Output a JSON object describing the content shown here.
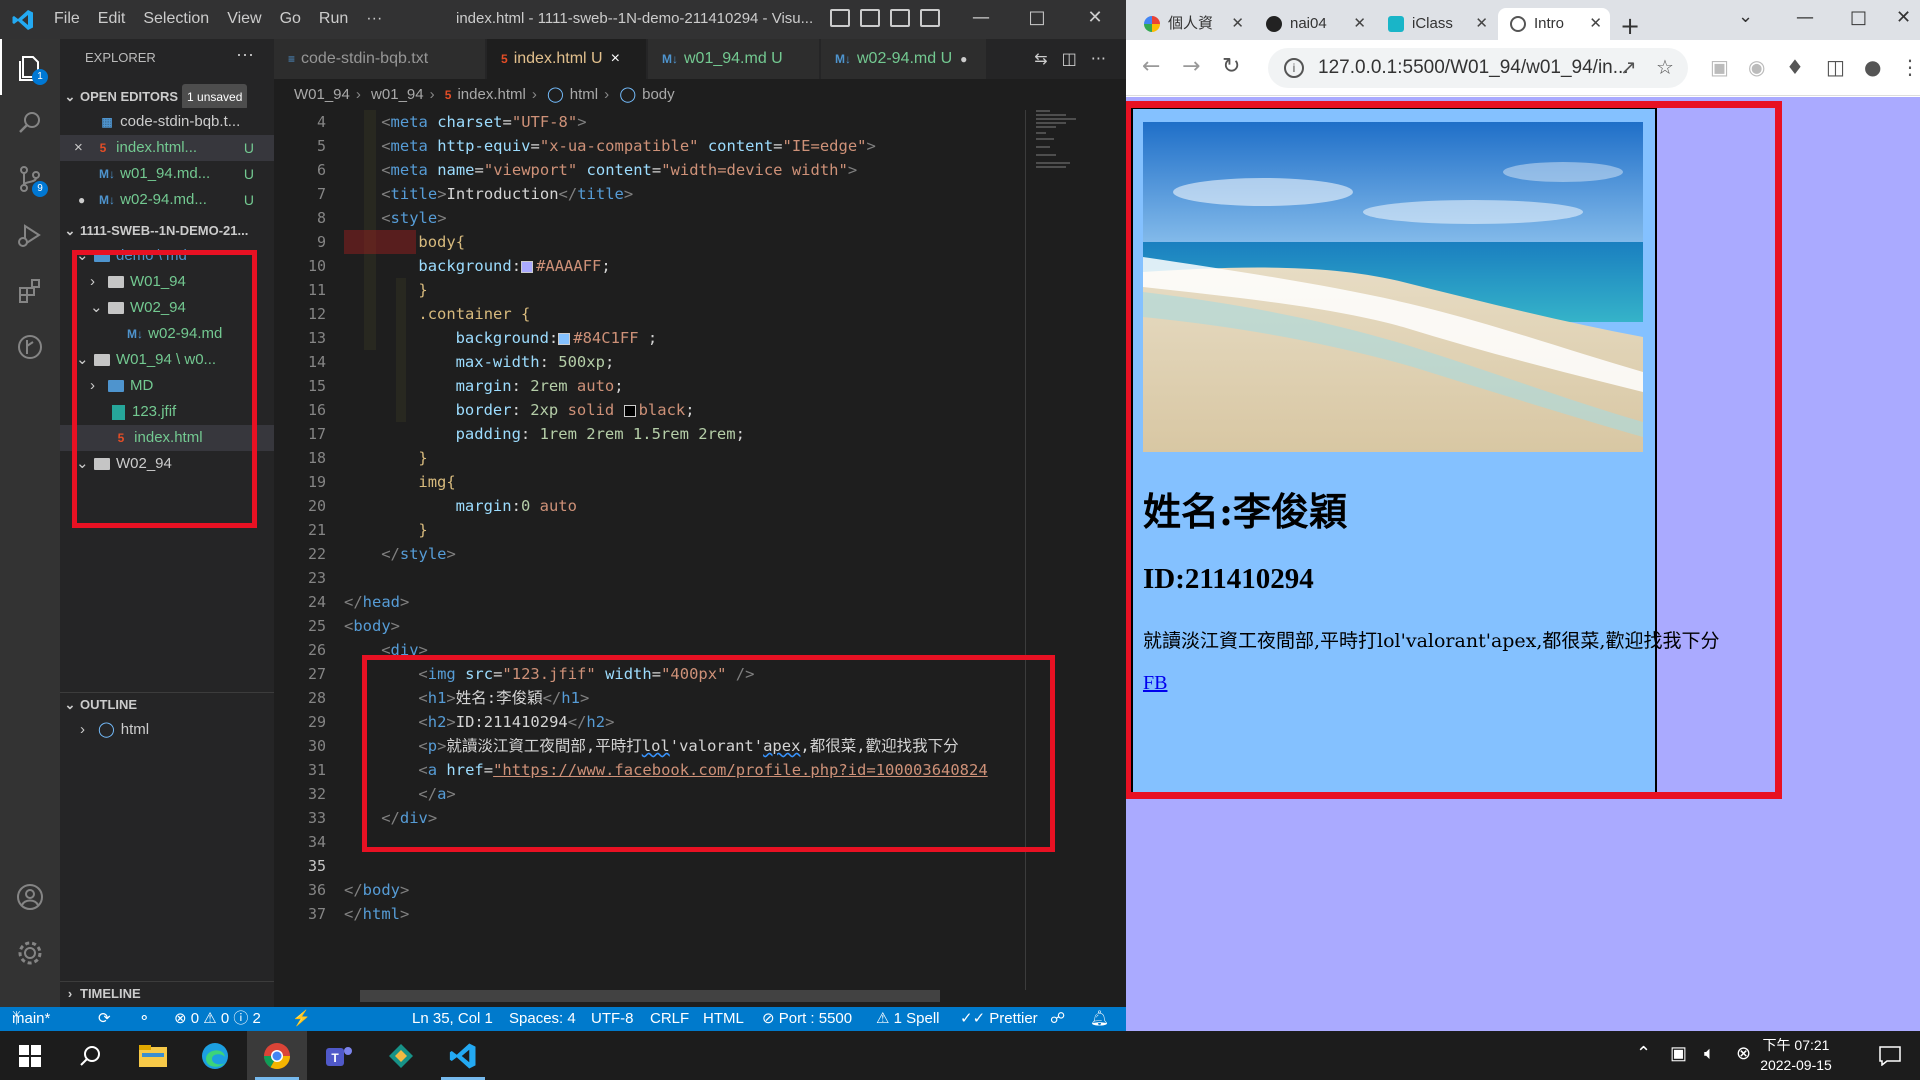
{
  "vscode": {
    "menu": [
      "File",
      "Edit",
      "Selection",
      "View",
      "Go",
      "Run",
      "···"
    ],
    "window_title": "index.html - 1111-sweb--1N-demo-211410294 - Visu...",
    "explorer": {
      "title": "EXPLORER",
      "open_editors_label": "OPEN EDITORS",
      "unsaved_badge": "1 unsaved",
      "open_editors": [
        {
          "name": "code-stdin-bqb.t...",
          "icon": "MD",
          "mark": ""
        },
        {
          "name": "index.html...",
          "icon": "HTML",
          "mark": "U",
          "close": "×"
        },
        {
          "name": "w01_94.md...",
          "icon": "M↓",
          "mark": "U"
        },
        {
          "name": "w02-94.md...",
          "icon": "M↓",
          "mark": "U",
          "dot": "●"
        }
      ],
      "workspace_label": "1111-SWEB--1N-DEMO-21...",
      "tree": [
        {
          "name": "demo \\ md",
          "kind": "folder-md",
          "depth": 1,
          "chev": "⌄"
        },
        {
          "name": "W01_94",
          "kind": "folder",
          "depth": 2,
          "chev": "›"
        },
        {
          "name": "W02_94",
          "kind": "folder",
          "depth": 2,
          "chev": "⌄"
        },
        {
          "name": "w02-94.md",
          "kind": "md",
          "depth": 3,
          "chev": ""
        },
        {
          "name": "W01_94 \\ w0...",
          "kind": "folder",
          "depth": 1,
          "chev": "⌄"
        },
        {
          "name": "MD",
          "kind": "folder-md",
          "depth": 2,
          "chev": "›"
        },
        {
          "name": "123.jfif",
          "kind": "img",
          "depth": 2,
          "chev": ""
        },
        {
          "name": "index.html",
          "kind": "html",
          "depth": 2,
          "chev": ""
        },
        {
          "name": "W02_94",
          "kind": "folder",
          "depth": 1,
          "chev": "⌄"
        }
      ],
      "outline_label": "OUTLINE",
      "outline_item": "html",
      "timeline_label": "TIMELINE"
    },
    "tabs": [
      {
        "label": "code-stdin-bqb.txt",
        "icon": "≡",
        "mod": "",
        "active": false
      },
      {
        "label": "index.html U",
        "icon": "5",
        "mod": "×",
        "active": true
      },
      {
        "label": "w01_94.md U",
        "icon": "M↓",
        "mod": "",
        "active": false
      },
      {
        "label": "w02-94.md U",
        "icon": "M↓",
        "mod": "●",
        "active": false
      }
    ],
    "breadcrumb": [
      "W01_94",
      "w01_94",
      "index.html",
      "html",
      "body"
    ],
    "line_numbers": [
      "4",
      "5",
      "6",
      "7",
      "8",
      "9",
      "10",
      "11",
      "12",
      "13",
      "14",
      "15",
      "16",
      "17",
      "18",
      "19",
      "20",
      "21",
      "22",
      "23",
      "24",
      "25",
      "26",
      "27",
      "28",
      "29",
      "30",
      "31",
      "32",
      "33",
      "34",
      "35",
      "36",
      "37"
    ],
    "current_line": "35",
    "code": {
      "l4": [
        "<",
        "meta",
        " charset",
        "=",
        "\"UTF-8\"",
        ">"
      ],
      "l5": [
        "<",
        "meta",
        " http-equiv",
        "=",
        "\"x-ua-compatible\"",
        " content",
        "=",
        "\"IE=edge\"",
        ">"
      ],
      "l6": [
        "<",
        "meta",
        " name",
        "=",
        "\"viewport\"",
        " content",
        "=",
        "\"width=device width\"",
        ">"
      ],
      "l7": [
        "<",
        "title",
        ">",
        "Introduction",
        "</",
        "title",
        ">"
      ],
      "l8": [
        "<",
        "style",
        ">"
      ],
      "l9": [
        "body{"
      ],
      "l10": [
        "background",
        ":",
        "#AAAAFF",
        ";"
      ],
      "l11": [
        "}"
      ],
      "l12": [
        ".container {"
      ],
      "l13": [
        "background",
        ":",
        "#84C1FF",
        " ;"
      ],
      "l14": [
        "max-width",
        ": ",
        "500xp",
        ";"
      ],
      "l15": [
        "margin",
        ": ",
        "2rem",
        " auto",
        ";"
      ],
      "l16": [
        "border",
        ": ",
        "2xp",
        " solid ",
        "black",
        ";"
      ],
      "l17": [
        "padding",
        ": ",
        "1rem 2rem 1.5rem 2rem",
        ";"
      ],
      "l18": [
        "}"
      ],
      "l19": [
        "img{"
      ],
      "l20": [
        "margin",
        ":",
        "0",
        " auto"
      ],
      "l21": [
        "}"
      ],
      "l22": [
        "</",
        "style",
        ">"
      ],
      "l24": [
        "</",
        "head",
        ">"
      ],
      "l25": [
        "<",
        "body",
        ">"
      ],
      "l26": [
        "<",
        "div",
        ">"
      ],
      "l27": [
        "<",
        "img",
        " src",
        "=",
        "\"123.jfif\"",
        " width",
        "=",
        "\"400px\"",
        " />"
      ],
      "l28": [
        "<",
        "h1",
        ">",
        "姓名:李俊穎",
        "</",
        "h1",
        ">"
      ],
      "l29": [
        "<",
        "h2",
        ">",
        "ID:211410294",
        "</",
        "h2",
        ">"
      ],
      "l30": [
        "<",
        "p",
        ">",
        "就讀淡江資工夜間部,平時打",
        "lol",
        "'valorant'",
        "apex",
        ",都很菜,歡迎找我下分"
      ],
      "l31": [
        "<",
        "a",
        " href",
        "=",
        "\"https://www.facebook.com/profile.php?id=100003640824"
      ],
      "l32": [
        "</",
        "a",
        ">"
      ],
      "l33": [
        "</",
        "div",
        ">"
      ],
      "l36": [
        "</",
        "body",
        ">"
      ],
      "l37": [
        "</",
        "html",
        ">"
      ]
    },
    "status": {
      "branch": "main*",
      "problems": "⊗ 0 ⚠ 0 ⓘ 2",
      "cursor": "Ln 35, Col 1",
      "spaces": "Spaces: 4",
      "encoding": "UTF-8",
      "eol": "CRLF",
      "language": "HTML",
      "port": "⊘ Port : 5500",
      "spell": "⚠ 1 Spell",
      "prettier": "✓✓ Prettier"
    }
  },
  "chrome": {
    "tabs": [
      {
        "label": "個人資",
        "fav": "G"
      },
      {
        "label": "nai04",
        "fav": "gh"
      },
      {
        "label": "iClass",
        "fav": "ic"
      },
      {
        "label": "Intro",
        "fav": "globe",
        "active": true
      }
    ],
    "new_tab": "+",
    "url": "127.0.0.1:5500/W01_94/w01_94/in...",
    "page": {
      "name": "姓名:李俊穎",
      "id": "ID:211410294",
      "desc": "就讀淡江資工夜間部,平時打lol'valorant'apex,都很菜,歡迎找我下分",
      "link": "FB",
      "image_subject": "beach"
    },
    "colors": {
      "page_bg": "#AAAAFF",
      "container_bg": "#84C1FF",
      "highlight": "#E81123"
    }
  },
  "taskbar": {
    "apps": [
      "start-icon",
      "search-icon",
      "file-explorer-icon",
      "edge-icon",
      "chrome-icon",
      "teams-icon",
      "gitkraken-icon",
      "vscode-icon"
    ],
    "time_ampm": "下午 07:21",
    "date": "2022-09-15"
  }
}
